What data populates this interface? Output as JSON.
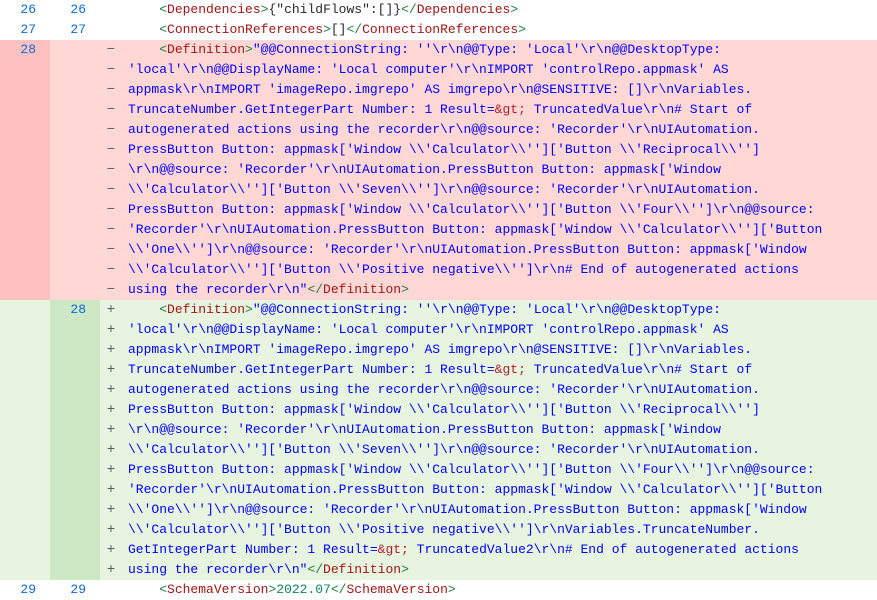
{
  "rows": [
    {
      "type": "ctx",
      "old": "26",
      "new": "26",
      "marker": "",
      "segments": [
        {
          "t": "    ",
          "c": ""
        },
        {
          "t": "<",
          "c": "tag"
        },
        {
          "t": "Dependencies",
          "c": "tagname"
        },
        {
          "t": ">",
          "c": "tag"
        },
        {
          "t": "{\"childFlows\":[]}",
          "c": ""
        },
        {
          "t": "</",
          "c": "tag"
        },
        {
          "t": "Dependencies",
          "c": "tagname"
        },
        {
          "t": ">",
          "c": "tag"
        }
      ]
    },
    {
      "type": "ctx",
      "old": "27",
      "new": "27",
      "marker": "",
      "segments": [
        {
          "t": "    ",
          "c": ""
        },
        {
          "t": "<",
          "c": "tag"
        },
        {
          "t": "ConnectionReferences",
          "c": "tagname"
        },
        {
          "t": ">",
          "c": "tag"
        },
        {
          "t": "[]",
          "c": ""
        },
        {
          "t": "</",
          "c": "tag"
        },
        {
          "t": "ConnectionReferences",
          "c": "tagname"
        },
        {
          "t": ">",
          "c": "tag"
        }
      ]
    },
    {
      "type": "del",
      "old": "28",
      "new": "",
      "marker": "−",
      "segments": [
        {
          "t": "    ",
          "c": ""
        },
        {
          "t": "<",
          "c": "tag"
        },
        {
          "t": "Definition",
          "c": "tagname"
        },
        {
          "t": ">",
          "c": "tag"
        },
        {
          "t": "\"@@ConnectionString: ''\\r\\n@@Type: 'Local'\\r\\n@@DesktopType: ",
          "c": "str"
        }
      ]
    },
    {
      "type": "del",
      "old": "",
      "new": "",
      "marker": "−",
      "segments": [
        {
          "t": "'local'\\r\\n@@DisplayName: 'Local computer'\\r\\nIMPORT 'controlRepo.appmask' AS ",
          "c": "str"
        }
      ]
    },
    {
      "type": "del",
      "old": "",
      "new": "",
      "marker": "−",
      "segments": [
        {
          "t": "appmask\\r\\nIMPORT 'imageRepo.imgrepo' AS imgrepo\\r\\n@SENSITIVE: []\\r\\nVariables.",
          "c": "str"
        }
      ]
    },
    {
      "type": "del",
      "old": "",
      "new": "",
      "marker": "−",
      "segments": [
        {
          "t": "TruncateNumber.GetIntegerPart Number: 1 Result=",
          "c": "str"
        },
        {
          "t": "&gt;",
          "c": "ent"
        },
        {
          "t": " TruncatedValue\\r\\n# Start of ",
          "c": "str"
        }
      ]
    },
    {
      "type": "del",
      "old": "",
      "new": "",
      "marker": "−",
      "segments": [
        {
          "t": "autogenerated actions using the recorder\\r\\n@@source: 'Recorder'\\r\\nUIAutomation.",
          "c": "str"
        }
      ]
    },
    {
      "type": "del",
      "old": "",
      "new": "",
      "marker": "−",
      "segments": [
        {
          "t": "PressButton Button: appmask['Window \\\\'Calculator\\\\'']['Button \\\\'Reciprocal\\\\'']",
          "c": "str"
        }
      ]
    },
    {
      "type": "del",
      "old": "",
      "new": "",
      "marker": "−",
      "segments": [
        {
          "t": "\\r\\n@@source: 'Recorder'\\r\\nUIAutomation.PressButton Button: appmask['Window ",
          "c": "str"
        }
      ]
    },
    {
      "type": "del",
      "old": "",
      "new": "",
      "marker": "−",
      "segments": [
        {
          "t": "\\\\'Calculator\\\\'']['Button \\\\'Seven\\\\'']\\r\\n@@source: 'Recorder'\\r\\nUIAutomation.",
          "c": "str"
        }
      ]
    },
    {
      "type": "del",
      "old": "",
      "new": "",
      "marker": "−",
      "segments": [
        {
          "t": "PressButton Button: appmask['Window \\\\'Calculator\\\\'']['Button \\\\'Four\\\\'']\\r\\n@@source: ",
          "c": "str"
        }
      ]
    },
    {
      "type": "del",
      "old": "",
      "new": "",
      "marker": "−",
      "segments": [
        {
          "t": "'Recorder'\\r\\nUIAutomation.PressButton Button: appmask['Window \\\\'Calculator\\\\'']['Button ",
          "c": "str"
        }
      ]
    },
    {
      "type": "del",
      "old": "",
      "new": "",
      "marker": "−",
      "segments": [
        {
          "t": "\\\\'One\\\\'']\\r\\n@@source: 'Recorder'\\r\\nUIAutomation.PressButton Button: appmask['Window ",
          "c": "str"
        }
      ]
    },
    {
      "type": "del",
      "old": "",
      "new": "",
      "marker": "−",
      "segments": [
        {
          "t": "\\\\'Calculator\\\\'']['Button \\\\'Positive negative\\\\'']\\r\\n# End of autogenerated actions ",
          "c": "str"
        }
      ]
    },
    {
      "type": "del",
      "old": "",
      "new": "",
      "marker": "−",
      "segments": [
        {
          "t": "using the recorder\\r\\n\"",
          "c": "str"
        },
        {
          "t": "</",
          "c": "tag"
        },
        {
          "t": "Definition",
          "c": "tagname"
        },
        {
          "t": ">",
          "c": "tag"
        }
      ]
    },
    {
      "type": "add",
      "old": "",
      "new": "28",
      "marker": "+",
      "segments": [
        {
          "t": "    ",
          "c": ""
        },
        {
          "t": "<",
          "c": "tag"
        },
        {
          "t": "Definition",
          "c": "tagname"
        },
        {
          "t": ">",
          "c": "tag"
        },
        {
          "t": "\"@@ConnectionString: ''\\r\\n@@Type: 'Local'\\r\\n@@DesktopType: ",
          "c": "str"
        }
      ]
    },
    {
      "type": "add",
      "old": "",
      "new": "",
      "marker": "+",
      "segments": [
        {
          "t": "'local'\\r\\n@@DisplayName: 'Local computer'\\r\\nIMPORT 'controlRepo.appmask' AS ",
          "c": "str"
        }
      ]
    },
    {
      "type": "add",
      "old": "",
      "new": "",
      "marker": "+",
      "segments": [
        {
          "t": "appmask\\r\\nIMPORT 'imageRepo.imgrepo' AS imgrepo\\r\\n@SENSITIVE: []\\r\\nVariables.",
          "c": "str"
        }
      ]
    },
    {
      "type": "add",
      "old": "",
      "new": "",
      "marker": "+",
      "segments": [
        {
          "t": "TruncateNumber.GetIntegerPart Number: 1 Result=",
          "c": "str"
        },
        {
          "t": "&gt;",
          "c": "ent"
        },
        {
          "t": " TruncatedValue\\r\\n# Start of ",
          "c": "str"
        }
      ]
    },
    {
      "type": "add",
      "old": "",
      "new": "",
      "marker": "+",
      "segments": [
        {
          "t": "autogenerated actions using the recorder\\r\\n@@source: 'Recorder'\\r\\nUIAutomation.",
          "c": "str"
        }
      ]
    },
    {
      "type": "add",
      "old": "",
      "new": "",
      "marker": "+",
      "segments": [
        {
          "t": "PressButton Button: appmask['Window \\\\'Calculator\\\\'']['Button \\\\'Reciprocal\\\\'']",
          "c": "str"
        }
      ]
    },
    {
      "type": "add",
      "old": "",
      "new": "",
      "marker": "+",
      "segments": [
        {
          "t": "\\r\\n@@source: 'Recorder'\\r\\nUIAutomation.PressButton Button: appmask['Window ",
          "c": "str"
        }
      ]
    },
    {
      "type": "add",
      "old": "",
      "new": "",
      "marker": "+",
      "segments": [
        {
          "t": "\\\\'Calculator\\\\'']['Button \\\\'Seven\\\\'']\\r\\n@@source: 'Recorder'\\r\\nUIAutomation.",
          "c": "str"
        }
      ]
    },
    {
      "type": "add",
      "old": "",
      "new": "",
      "marker": "+",
      "segments": [
        {
          "t": "PressButton Button: appmask['Window \\\\'Calculator\\\\'']['Button \\\\'Four\\\\'']\\r\\n@@source: ",
          "c": "str"
        }
      ]
    },
    {
      "type": "add",
      "old": "",
      "new": "",
      "marker": "+",
      "segments": [
        {
          "t": "'Recorder'\\r\\nUIAutomation.PressButton Button: appmask['Window \\\\'Calculator\\\\'']['Button ",
          "c": "str"
        }
      ]
    },
    {
      "type": "add",
      "old": "",
      "new": "",
      "marker": "+",
      "segments": [
        {
          "t": "\\\\'One\\\\'']\\r\\n@@source: 'Recorder'\\r\\nUIAutomation.PressButton Button: appmask['Window ",
          "c": "str"
        }
      ]
    },
    {
      "type": "add",
      "old": "",
      "new": "",
      "marker": "+",
      "segments": [
        {
          "t": "\\\\'Calculator\\\\'']['Button \\\\'Positive negative\\\\'']\\r\\nVariables.TruncateNumber.",
          "c": "str"
        }
      ]
    },
    {
      "type": "add",
      "old": "",
      "new": "",
      "marker": "+",
      "segments": [
        {
          "t": "GetIntegerPart Number: 1 Result=",
          "c": "str"
        },
        {
          "t": "&gt;",
          "c": "ent"
        },
        {
          "t": " TruncatedValue2\\r\\n# End of autogenerated actions ",
          "c": "str"
        }
      ]
    },
    {
      "type": "add",
      "old": "",
      "new": "",
      "marker": "+",
      "segments": [
        {
          "t": "using the recorder\\r\\n\"",
          "c": "str"
        },
        {
          "t": "</",
          "c": "tag"
        },
        {
          "t": "Definition",
          "c": "tagname"
        },
        {
          "t": ">",
          "c": "tag"
        }
      ]
    },
    {
      "type": "ctx",
      "old": "29",
      "new": "29",
      "marker": "",
      "segments": [
        {
          "t": "    ",
          "c": ""
        },
        {
          "t": "<",
          "c": "tag"
        },
        {
          "t": "SchemaVersion",
          "c": "tagname"
        },
        {
          "t": ">",
          "c": "tag"
        },
        {
          "t": "2022.07",
          "c": "num"
        },
        {
          "t": "</",
          "c": "tag"
        },
        {
          "t": "SchemaVersion",
          "c": "tagname"
        },
        {
          "t": ">",
          "c": "tag"
        }
      ]
    }
  ]
}
